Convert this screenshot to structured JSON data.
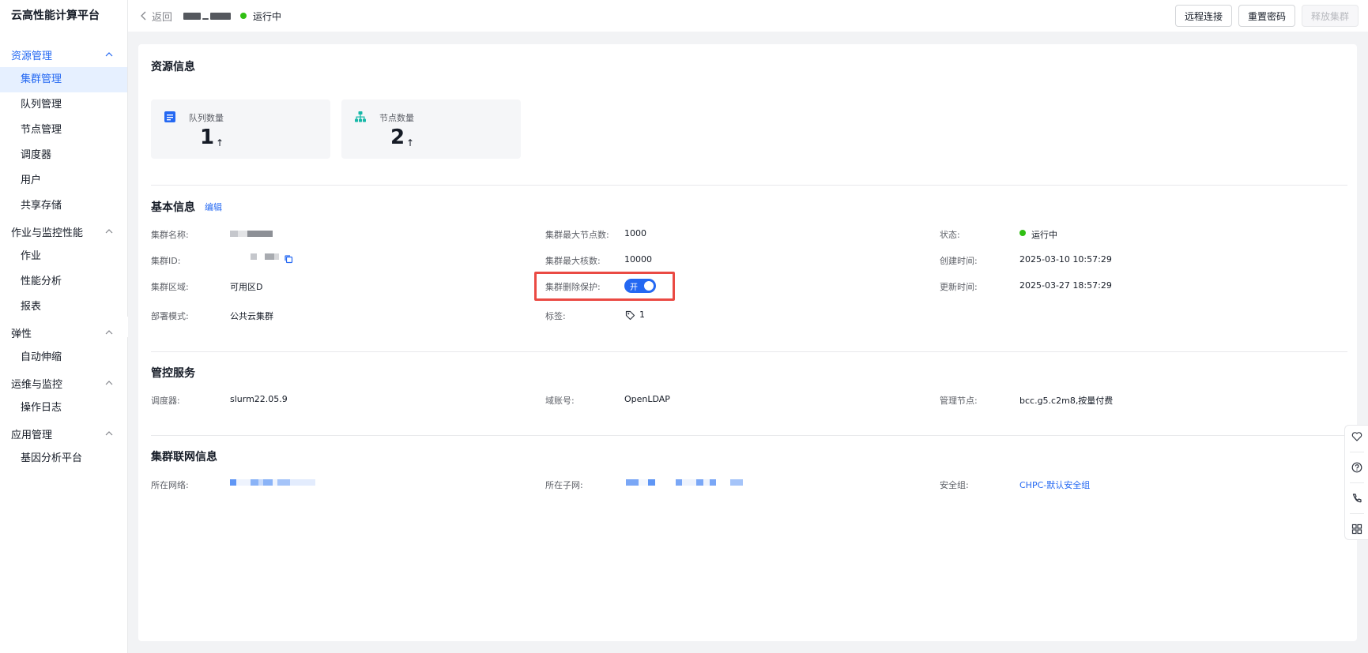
{
  "sidebar": {
    "brand": "云高性能计算平台",
    "groups": [
      {
        "label": "资源管理",
        "items": [
          "集群管理",
          "队列管理",
          "节点管理",
          "调度器",
          "用户",
          "共享存储"
        ]
      },
      {
        "label": "作业与监控性能",
        "items": [
          "作业",
          "性能分析",
          "报表"
        ]
      },
      {
        "label": "弹性",
        "items": [
          "自动伸缩"
        ]
      },
      {
        "label": "运维与监控",
        "items": [
          "操作日志"
        ]
      },
      {
        "label": "应用管理",
        "items": [
          "基因分析平台"
        ]
      }
    ],
    "active_item": "集群管理"
  },
  "topbar": {
    "back_label": "返回",
    "status": "运行中",
    "actions": [
      "远程连接",
      "重置密码",
      "释放集群"
    ]
  },
  "resource": {
    "title": "资源信息",
    "queue_label": "队列数量",
    "queue_count": "1",
    "node_label": "节点数量",
    "node_count": "2",
    "arrow": "↑"
  },
  "basic": {
    "title": "基本信息",
    "edit": "编辑",
    "name_label": "集群名称:",
    "id_label": "集群ID:",
    "zone_label": "集群区域:",
    "zone_value": "可用区D",
    "deploy_label": "部署模式:",
    "deploy_value": "公共云集群",
    "max_nodes_label": "集群最大节点数:",
    "max_nodes_value": "1000",
    "max_cores_label": "集群最大核数:",
    "max_cores_value": "10000",
    "protect_label": "集群删除保护:",
    "protect_toggle": "开",
    "tags_label": "标签:",
    "tags_value": "1",
    "status_label": "状态:",
    "status_value": "运行中",
    "created_label": "创建时间:",
    "created_value": "2025-03-10 10:57:29",
    "updated_label": "更新时间:",
    "updated_value": "2025-03-27 18:57:29"
  },
  "control": {
    "title": "管控服务",
    "scheduler_label": "调度器:",
    "scheduler_value": "slurm22.05.9",
    "domain_label": "域账号:",
    "domain_value": "OpenLDAP",
    "mgmt_label": "管理节点:",
    "mgmt_value": "bcc.g5.c2m8,按量付费"
  },
  "network": {
    "title": "集群联网信息",
    "vpc_label": "所在网络:",
    "subnet_label": "所在子网:",
    "sg_label": "安全组:",
    "sg_value": "CHPC-默认安全组"
  },
  "colors": {
    "accent": "#2468f2",
    "running": "#30bf13",
    "highlight": "#ea4a43"
  }
}
